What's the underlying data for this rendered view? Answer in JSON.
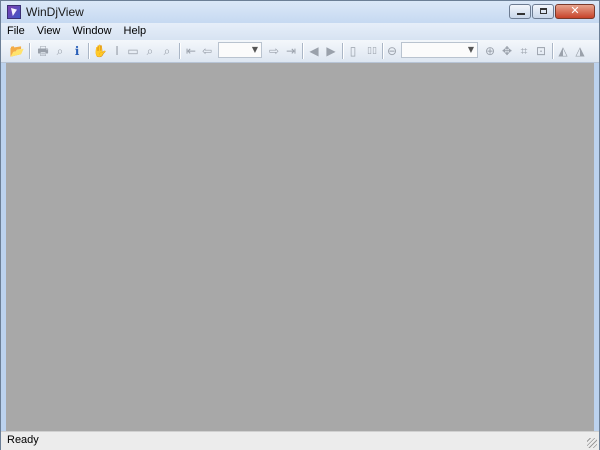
{
  "window": {
    "title": "WinDjView",
    "minimize_icon": "minimize-icon",
    "maximize_icon": "maximize-icon",
    "close_glyph": "✕"
  },
  "menu": {
    "items": [
      "File",
      "View",
      "Window",
      "Help"
    ]
  },
  "toolbar": {
    "buttons": [
      {
        "name": "open-icon",
        "glyph": "📂"
      },
      {
        "name": "print-icon",
        "glyph": "🖶"
      },
      {
        "name": "find-icon",
        "glyph": "⌕"
      },
      {
        "name": "info-icon",
        "glyph": "ℹ"
      },
      {
        "name": "hand-icon",
        "glyph": "✋"
      },
      {
        "name": "text-select-icon",
        "glyph": "I"
      },
      {
        "name": "rect-select-icon",
        "glyph": "▭"
      },
      {
        "name": "zoom-icon",
        "glyph": "⌕"
      },
      {
        "name": "zoom-rect-icon",
        "glyph": "⌕"
      },
      {
        "name": "first-page-icon",
        "glyph": "⇤"
      },
      {
        "name": "prev-page-icon",
        "glyph": "⇦"
      },
      {
        "name": "next-page-icon",
        "glyph": "⇨"
      },
      {
        "name": "last-page-icon",
        "glyph": "⇥"
      },
      {
        "name": "back-icon",
        "glyph": "◀"
      },
      {
        "name": "forward-icon",
        "glyph": "▶"
      },
      {
        "name": "single-page-icon",
        "glyph": "▯"
      },
      {
        "name": "facing-pages-icon",
        "glyph": "▯▯"
      },
      {
        "name": "zoom-out-icon",
        "glyph": "⊖"
      },
      {
        "name": "zoom-in-icon",
        "glyph": "⊕"
      },
      {
        "name": "fit-width-icon",
        "glyph": "✥"
      },
      {
        "name": "fit-page-icon",
        "glyph": "⌗"
      },
      {
        "name": "actual-size-icon",
        "glyph": "⊡"
      },
      {
        "name": "rotate-left-icon",
        "glyph": "◭"
      },
      {
        "name": "rotate-right-icon",
        "glyph": "◮"
      }
    ],
    "page_combo_value": "",
    "zoom_combo_value": "",
    "combo_arrow": "▼"
  },
  "status": {
    "text": "Ready"
  }
}
